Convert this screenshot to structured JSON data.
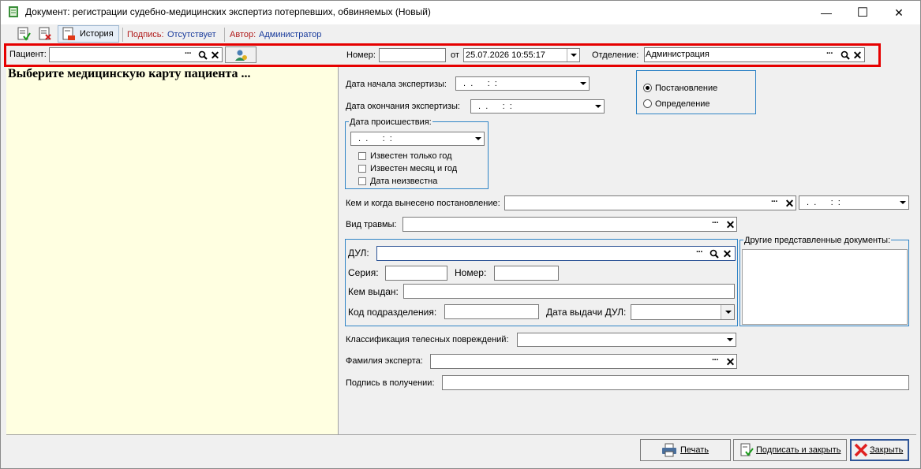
{
  "window": {
    "title": "Документ: регистрации судебно-медицинских экспертиз потерпевших, обвиняемых (Новый)",
    "minimize_glyph": "—",
    "maximize_glyph": "☐",
    "close_glyph": "✕"
  },
  "toolbar": {
    "history_label": "История",
    "signature_label": "Подпись:",
    "signature_value": "Отсутствует",
    "author_label": "Автор:",
    "author_value": "Администратор"
  },
  "header": {
    "patient_label": "Пациент:",
    "patient_value": "",
    "number_label": "Номер:",
    "number_value": "",
    "from_label": "от",
    "date_value": "25.07.2026 10:55:17",
    "department_label": "Отделение:",
    "department_value": "Администрация",
    "dots": "···",
    "clear": "✕",
    "highlight_color": "#e60000"
  },
  "left_panel": {
    "prompt": "Выберите медицинскую карту пациента ...",
    "background": "#ffffe1"
  },
  "form": {
    "exam_start_label": "Дата начала экспертизы:",
    "exam_start_value": " .  .      :  :",
    "exam_end_label": "Дата окончания экспертизы:",
    "exam_end_value": " .  .      :  :",
    "incident_group_title": "Дата происшествия:",
    "incident_date_value": " .  .      :  :",
    "cb_year_only": "Известен только год",
    "cb_month_year": "Известен месяц и год",
    "cb_unknown": "Дата неизвестна",
    "radio_resolution": "Постановление",
    "radio_definition": "Определение",
    "issued_by_label": "Кем и когда вынесено постановление:",
    "issued_by_value": "",
    "issued_date_value": " .  .      :  :",
    "injury_type_label": "Вид травмы:",
    "injury_type_value": "",
    "dul_label": "ДУЛ:",
    "series_label": "Серия:",
    "dul_number_label": "Номер:",
    "issued_by_dul_label": "Кем выдан:",
    "division_code_label": "Код подразделения:",
    "dul_issue_date_label": "Дата выдачи ДУЛ:",
    "other_docs_title": "Другие представленные документы:",
    "injury_class_label": "Классификация телесных повреждений:",
    "expert_name_label": "Фамилия эксперта:",
    "receipt_signature_label": "Подпись в получении:"
  },
  "buttons": {
    "print": "Печать",
    "sign_close": "Подписать и закрыть",
    "close": "Закрыть"
  }
}
